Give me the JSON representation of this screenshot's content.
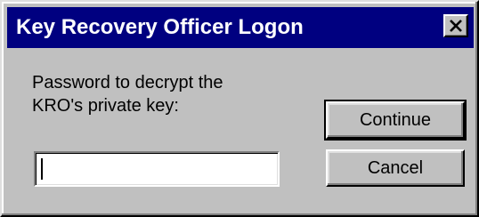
{
  "window": {
    "title": "Key Recovery Officer Logon",
    "close_icon": "close-x-icon"
  },
  "prompt": {
    "line1": "Password to decrypt the",
    "line2": "KRO's private key:"
  },
  "password_field": {
    "value": "",
    "placeholder": ""
  },
  "buttons": {
    "continue_label": "Continue",
    "cancel_label": "Cancel"
  },
  "colors": {
    "titlebar": "#000080",
    "face": "#c0c0c0",
    "title_text": "#ffffff"
  }
}
